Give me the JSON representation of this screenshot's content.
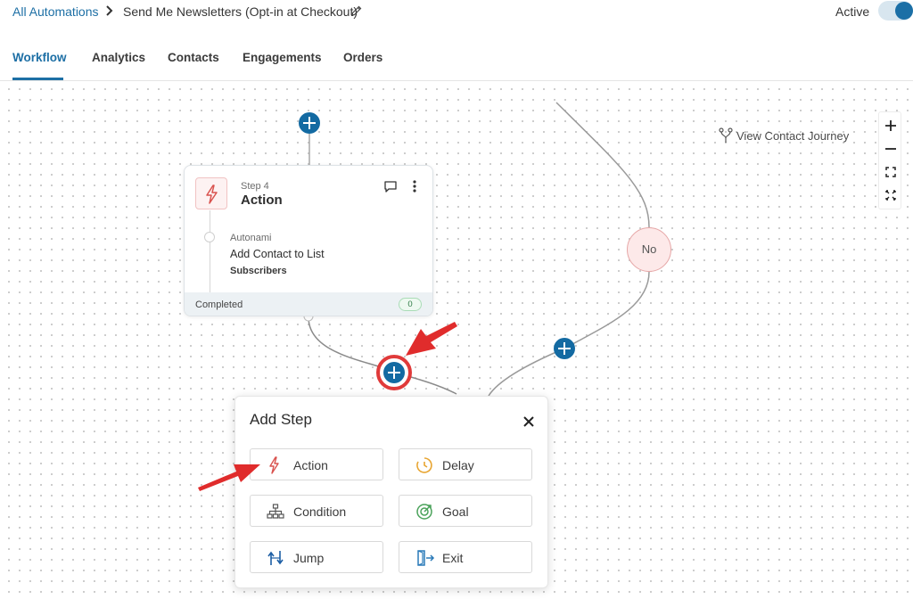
{
  "header": {
    "breadcrumb_root": "All Automations",
    "automation_title": "Send Me Newsletters (Opt-in at Checkout)",
    "active_label": "Active",
    "active": true
  },
  "tabs": [
    {
      "label": "Workflow",
      "active": true
    },
    {
      "label": "Analytics",
      "active": false
    },
    {
      "label": "Contacts",
      "active": false
    },
    {
      "label": "Engagements",
      "active": false
    },
    {
      "label": "Orders",
      "active": false
    }
  ],
  "canvas": {
    "view_contact_journey": "View Contact Journey",
    "no_node_label": "No",
    "zoom_controls": [
      "zoom-in-icon",
      "zoom-out-icon",
      "fit-screen-icon",
      "fullscreen-icon"
    ]
  },
  "step": {
    "number_label": "Step 4",
    "type_label": "Action",
    "provider": "Autonami",
    "task": "Add Contact to List",
    "list_name": "Subscribers",
    "status": "Completed",
    "count": "0",
    "icon": "lightning-icon"
  },
  "add_step": {
    "title": "Add Step",
    "options": [
      {
        "label": "Action",
        "icon": "lightning-icon",
        "color": "#d9534f"
      },
      {
        "label": "Delay",
        "icon": "clock-icon",
        "color": "#e8a531"
      },
      {
        "label": "Condition",
        "icon": "hierarchy-icon",
        "color": "#555555"
      },
      {
        "label": "Goal",
        "icon": "target-icon",
        "color": "#4aa25a"
      },
      {
        "label": "Jump",
        "icon": "jump-icon",
        "color": "#1d5fa5"
      },
      {
        "label": "Exit",
        "icon": "exit-icon",
        "color": "#2a7ab8"
      }
    ]
  },
  "colors": {
    "accent": "#1d6fa5",
    "plus_button": "#136aa2",
    "highlight_red": "#e03a3a"
  }
}
